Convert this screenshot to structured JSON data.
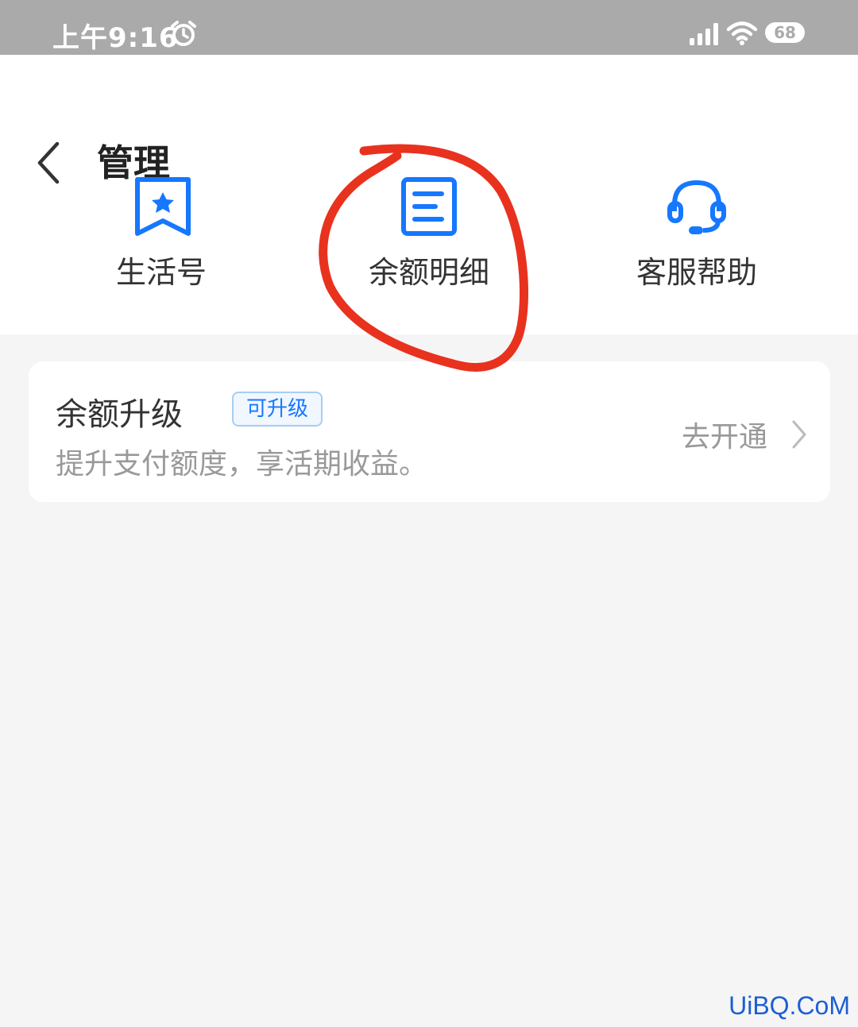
{
  "status_bar": {
    "time": "上午9:16",
    "battery": "68",
    "icons": [
      "alarm-icon",
      "signal-icon",
      "wifi-icon",
      "battery-icon"
    ]
  },
  "header": {
    "title": "管理",
    "back_icon": "back-icon"
  },
  "shortcuts": [
    {
      "label": "生活号",
      "icon": "life-account-icon"
    },
    {
      "label": "余额明细",
      "icon": "balance-details-icon"
    },
    {
      "label": "客服帮助",
      "icon": "customer-service-icon"
    }
  ],
  "upgrade_card": {
    "title": "余额升级",
    "badge": "可升级",
    "subtitle": "提升支付额度，享活期收益。",
    "action": "去开通"
  },
  "watermark": "UiBQ.CoM",
  "colors": {
    "accent": "#1677ff",
    "annotation": "#e8321e",
    "status_bar": "#aaaaaa"
  }
}
